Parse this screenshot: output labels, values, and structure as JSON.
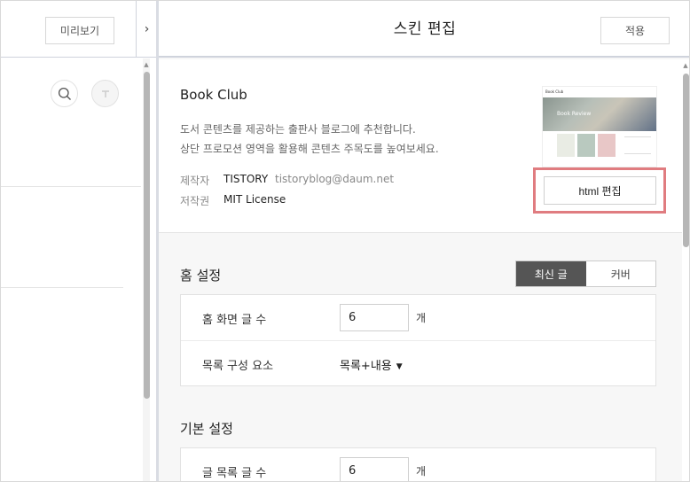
{
  "left": {
    "preview_label": "미리보기",
    "toggle_icon": "chevron-right-icon"
  },
  "header": {
    "title": "스킨 편집",
    "apply_label": "적용"
  },
  "skin": {
    "name": "Book Club",
    "desc_line1": "도서 콘텐츠를 제공하는 출판사 블로그에 추천합니다.",
    "desc_line2": "상단 프로모션 영역을 활용해 콘텐츠 주목도를 높여보세요.",
    "author_label": "제작자",
    "author_name": "TISTORY",
    "author_email": "tistoryblog@daum.net",
    "license_label": "저작권",
    "license_value": "MIT License",
    "thumbnail": {
      "blog_title": "Book Club",
      "hero_text": "Book Review"
    },
    "html_edit_label": "html 편집"
  },
  "home_settings": {
    "title": "홈 설정",
    "tabs": [
      {
        "label": "최신 글",
        "active": true
      },
      {
        "label": "커버",
        "active": false
      }
    ],
    "post_count_label": "홈 화면 글 수",
    "post_count_value": "6",
    "post_count_unit": "개",
    "list_element_label": "목록 구성 요소",
    "list_element_value": "목록+내용"
  },
  "basic_settings": {
    "title": "기본 설정",
    "list_count_label": "글 목록 글 수",
    "list_count_value": "6",
    "list_count_unit": "개"
  },
  "colors": {
    "highlight": "#e07c80",
    "active_tab": "#555555",
    "pane_bg": "#f7f7f7"
  }
}
